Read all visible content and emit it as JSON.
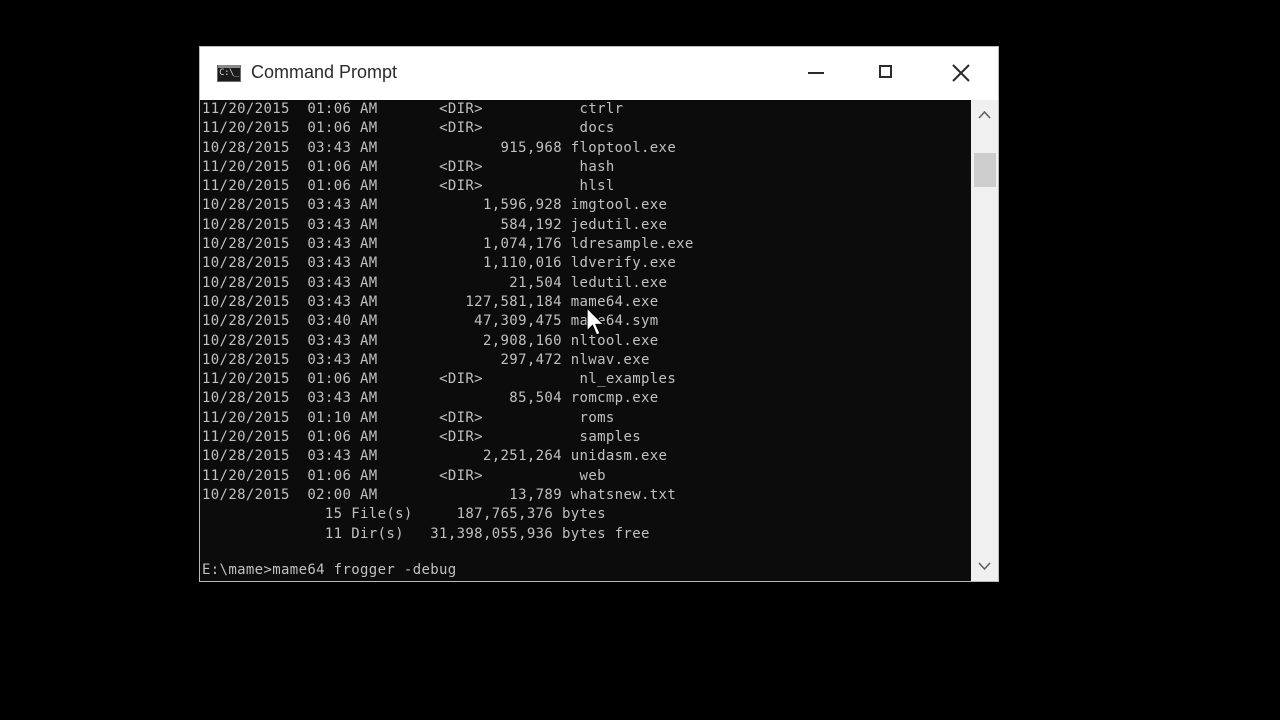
{
  "window": {
    "title": "Command Prompt",
    "icon_label": "C:\\_",
    "controls": {
      "minimize": "minimize-icon",
      "maximize": "maximize-icon",
      "close": "close-icon"
    }
  },
  "console": {
    "lines": [
      {
        "date": "11/20/2015",
        "time": "01:06 AM",
        "type": "<DIR>",
        "size": "",
        "name": "ctrlr"
      },
      {
        "date": "11/20/2015",
        "time": "01:06 AM",
        "type": "<DIR>",
        "size": "",
        "name": "docs"
      },
      {
        "date": "10/28/2015",
        "time": "03:43 AM",
        "type": "",
        "size": "915,968",
        "name": "floptool.exe"
      },
      {
        "date": "11/20/2015",
        "time": "01:06 AM",
        "type": "<DIR>",
        "size": "",
        "name": "hash"
      },
      {
        "date": "11/20/2015",
        "time": "01:06 AM",
        "type": "<DIR>",
        "size": "",
        "name": "hlsl"
      },
      {
        "date": "10/28/2015",
        "time": "03:43 AM",
        "type": "",
        "size": "1,596,928",
        "name": "imgtool.exe"
      },
      {
        "date": "10/28/2015",
        "time": "03:43 AM",
        "type": "",
        "size": "584,192",
        "name": "jedutil.exe"
      },
      {
        "date": "10/28/2015",
        "time": "03:43 AM",
        "type": "",
        "size": "1,074,176",
        "name": "ldresample.exe"
      },
      {
        "date": "10/28/2015",
        "time": "03:43 AM",
        "type": "",
        "size": "1,110,016",
        "name": "ldverify.exe"
      },
      {
        "date": "10/28/2015",
        "time": "03:43 AM",
        "type": "",
        "size": "21,504",
        "name": "ledutil.exe"
      },
      {
        "date": "10/28/2015",
        "time": "03:43 AM",
        "type": "",
        "size": "127,581,184",
        "name": "mame64.exe"
      },
      {
        "date": "10/28/2015",
        "time": "03:40 AM",
        "type": "",
        "size": "47,309,475",
        "name": "mame64.sym"
      },
      {
        "date": "10/28/2015",
        "time": "03:43 AM",
        "type": "",
        "size": "2,908,160",
        "name": "nltool.exe"
      },
      {
        "date": "10/28/2015",
        "time": "03:43 AM",
        "type": "",
        "size": "297,472",
        "name": "nlwav.exe"
      },
      {
        "date": "11/20/2015",
        "time": "01:06 AM",
        "type": "<DIR>",
        "size": "",
        "name": "nl_examples"
      },
      {
        "date": "10/28/2015",
        "time": "03:43 AM",
        "type": "",
        "size": "85,504",
        "name": "romcmp.exe"
      },
      {
        "date": "11/20/2015",
        "time": "01:10 AM",
        "type": "<DIR>",
        "size": "",
        "name": "roms"
      },
      {
        "date": "11/20/2015",
        "time": "01:06 AM",
        "type": "<DIR>",
        "size": "",
        "name": "samples"
      },
      {
        "date": "10/28/2015",
        "time": "03:43 AM",
        "type": "",
        "size": "2,251,264",
        "name": "unidasm.exe"
      },
      {
        "date": "11/20/2015",
        "time": "01:06 AM",
        "type": "<DIR>",
        "size": "",
        "name": "web"
      },
      {
        "date": "10/28/2015",
        "time": "02:00 AM",
        "type": "",
        "size": "13,789",
        "name": "whatsnew.txt"
      }
    ],
    "summary": [
      {
        "count": "15",
        "label": "File(s)",
        "amount": "187,765,376",
        "unit": "bytes"
      },
      {
        "count": "11",
        "label": "Dir(s)",
        "amount": "31,398,055,936",
        "unit": "bytes free"
      }
    ],
    "prompt": "E:\\mame>",
    "command": "mame64 frogger -debug"
  },
  "scrollbar": {
    "up_icon": "scroll-up-arrow-icon",
    "down_icon": "scroll-down-arrow-icon"
  },
  "colors": {
    "console_bg": "#0c0c0c",
    "console_text": "#c0c0c0",
    "titlebar_bg": "#ffffff",
    "scrollbar_bg": "#f0f0f0"
  }
}
